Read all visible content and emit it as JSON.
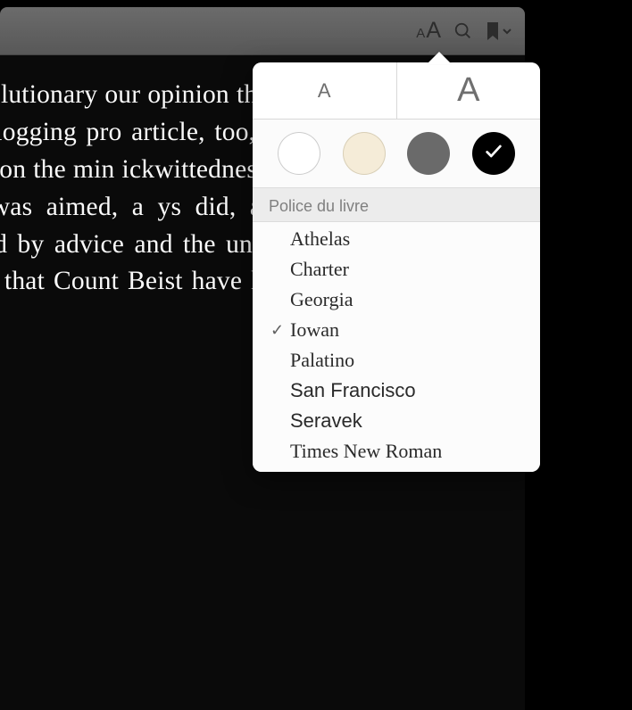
{
  "toolbar": {
    "appearance_small": "A",
    "appearance_large": "A"
  },
  "reader": {
    "paragraph": "h the revolutionary our opinion the da volutionary hydra, b alism clogging pro article, too, a finan ham and Mill, and cting on the min ickwittedness he ca divined whence it nd it was aimed, a ys did, a certain s action was embittered by advice and the unsatisfactory state d. He read, too, that Count Beist have left for Wiesbaden, and that"
  },
  "popover": {
    "decrease_label": "A",
    "increase_label": "A",
    "themes": {
      "white": "#ffffff",
      "sepia": "#f5ecd8",
      "gray": "#6a6a6a",
      "black": "#000000",
      "selected": "black"
    },
    "font_section_header": "Police du livre",
    "fonts": [
      {
        "name": "Athelas",
        "selected": false
      },
      {
        "name": "Charter",
        "selected": false
      },
      {
        "name": "Georgia",
        "selected": false
      },
      {
        "name": "Iowan",
        "selected": true
      },
      {
        "name": "Palatino",
        "selected": false
      },
      {
        "name": "San Francisco",
        "selected": false
      },
      {
        "name": "Seravek",
        "selected": false
      },
      {
        "name": "Times New Roman",
        "selected": false
      }
    ]
  }
}
